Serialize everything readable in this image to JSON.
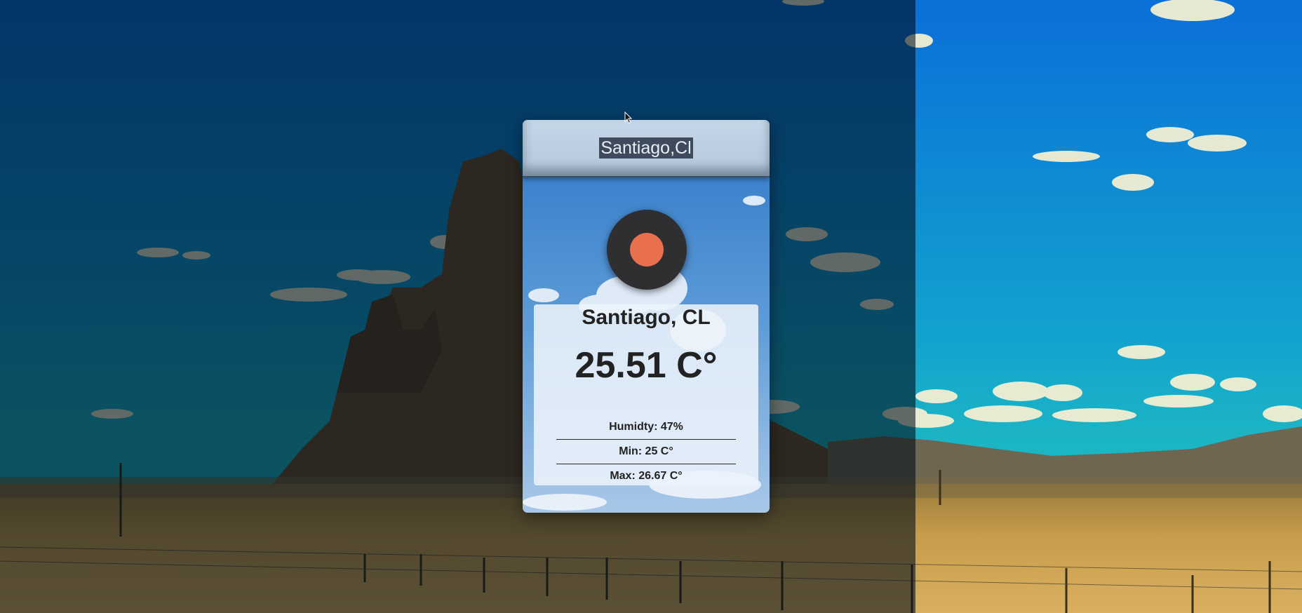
{
  "search": {
    "value": "Santiago,Cl",
    "selected": true
  },
  "weather": {
    "icon": "sun-icon",
    "location": "Santiago, CL",
    "temperature": "25.51 C°",
    "humidity": "Humidty: 47%",
    "min": "Min: 25 C°",
    "max": "Max: 26.67 C°"
  },
  "colors": {
    "sun": "#e8704d",
    "icon_bg": "#2f2f31",
    "search_bg": "#c5d7e8",
    "panel_bg": "#ecf3fa",
    "selection": "#3d4b5d"
  }
}
